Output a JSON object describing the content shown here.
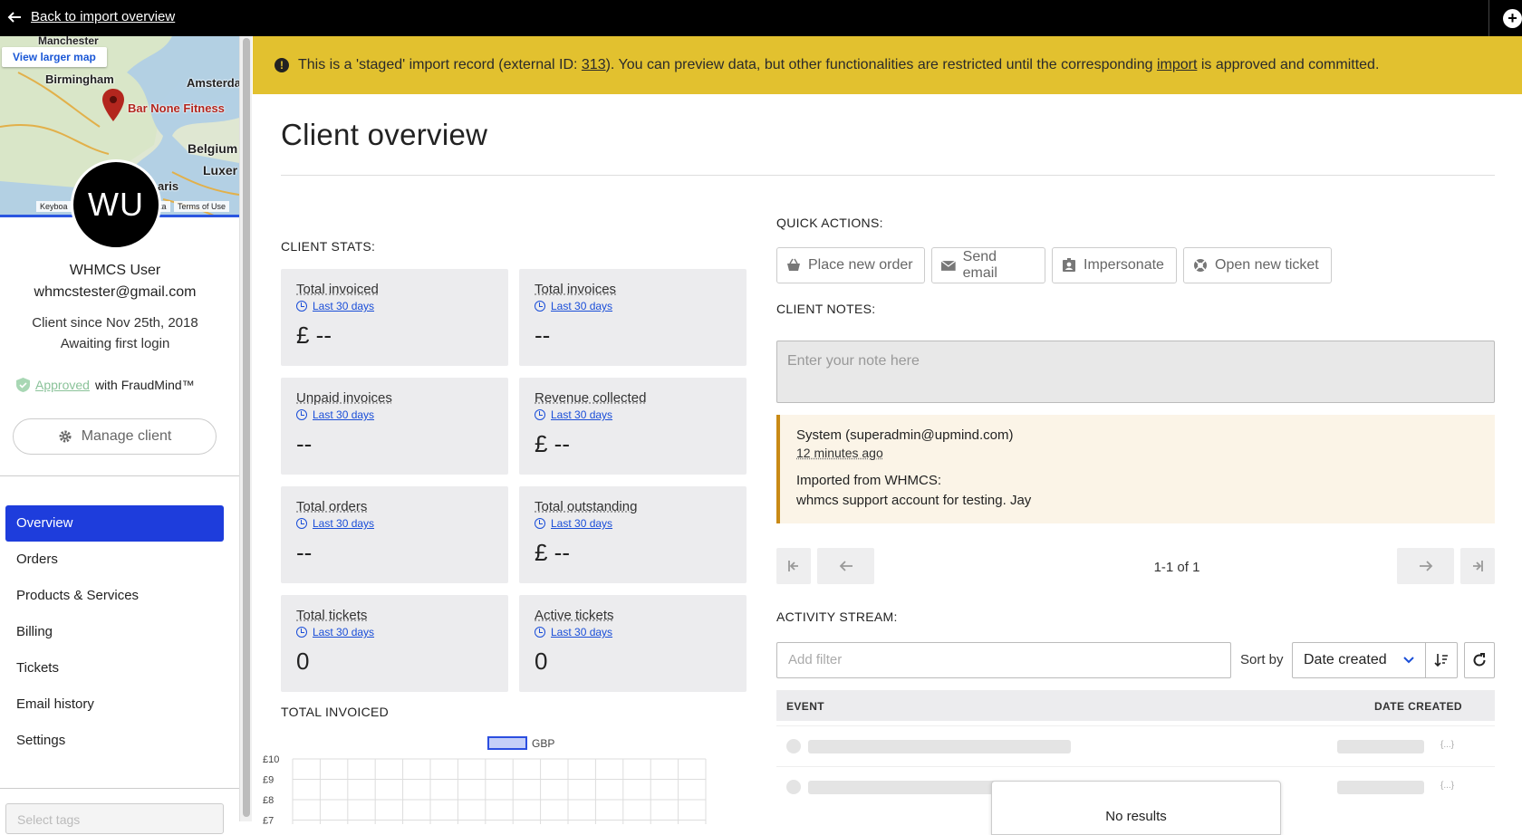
{
  "topbar": {
    "back_label": "Back to import overview"
  },
  "map": {
    "view_larger": "View larger map",
    "labels": [
      "Manchester",
      "Birmingham",
      "Amsterda",
      "Bar None Fitness",
      "Belgium",
      "Luxer",
      "aris"
    ],
    "keyboard": "Keyboa",
    "data": "ta",
    "terms": "Terms of Use"
  },
  "profile": {
    "initials": "WU",
    "name": "WHMCS User",
    "email": "whmcstester@gmail.com",
    "since": "Client since Nov 25th, 2018",
    "login_status": "Awaiting first login",
    "fraud_status": "Approved",
    "fraud_suffix": "with FraudMind™",
    "manage_label": "Manage client"
  },
  "nav": {
    "items": [
      "Overview",
      "Orders",
      "Products & Services",
      "Billing",
      "Tickets",
      "Email history",
      "Settings"
    ],
    "active": "Overview"
  },
  "tags": {
    "placeholder": "Select tags"
  },
  "banner": {
    "prefix": "This is a 'staged' import record (external ID: ",
    "external_id": "313",
    "middle": "). You can preview data, but other functionalities are restricted until the corresponding ",
    "link": "import",
    "suffix": " is approved and committed."
  },
  "page": {
    "title": "Client overview"
  },
  "stats": {
    "label": "CLIENT STATS:",
    "period": "Last 30 days",
    "cards": [
      {
        "title": "Total invoiced",
        "value": "£ --"
      },
      {
        "title": "Total invoices",
        "value": "--"
      },
      {
        "title": "Unpaid invoices",
        "value": "--"
      },
      {
        "title": "Revenue collected",
        "value": "£ --"
      },
      {
        "title": "Total orders",
        "value": "--"
      },
      {
        "title": "Total outstanding",
        "value": "£ --"
      },
      {
        "title": "Total tickets",
        "value": "0"
      },
      {
        "title": "Active tickets",
        "value": "0"
      }
    ]
  },
  "quick_actions": {
    "label": "QUICK ACTIONS:",
    "place_order": "Place new order",
    "send_email": "Send email",
    "impersonate": "Impersonate",
    "open_ticket": "Open new ticket"
  },
  "notes": {
    "label": "CLIENT NOTES:",
    "placeholder": "Enter your note here",
    "author": "System (superadmin@upmind.com)",
    "time": "12 minutes ago",
    "line1": "Imported from WHMCS:",
    "line2": "whmcs support account for testing. Jay",
    "pagination": "1-1 of 1"
  },
  "activity": {
    "label": "ACTIVITY STREAM:",
    "filter_placeholder": "Add filter",
    "sort_by": "Sort by",
    "sort_value": "Date created",
    "col_event": "EVENT",
    "col_date": "DATE CREATED",
    "json_tag": "{...}",
    "no_results": "No results"
  },
  "chart_data": {
    "type": "bar",
    "title": "TOTAL INVOICED",
    "series": [
      {
        "name": "GBP",
        "values": []
      }
    ],
    "y_ticks": [
      "£10",
      "£9",
      "£8",
      "£7"
    ],
    "ylim": [
      0,
      10
    ],
    "grid": true,
    "legend": "top-center",
    "colors": {
      "legend_fill": "#c5cff8",
      "legend_border": "#2b4ee0"
    }
  }
}
